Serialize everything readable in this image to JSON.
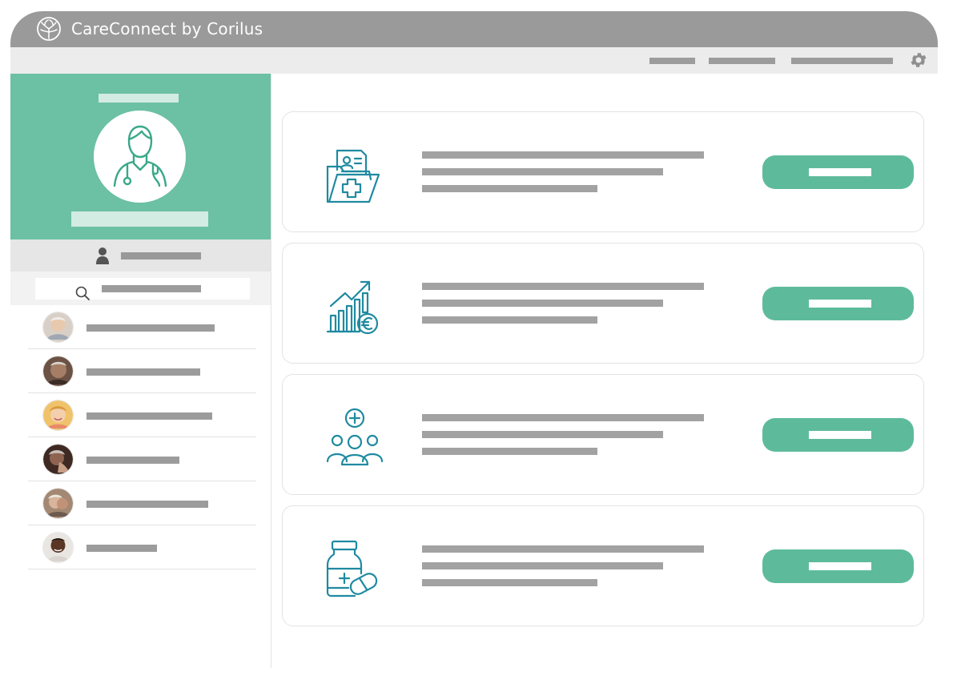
{
  "app": {
    "title": "CareConnect by Corilus",
    "logo_icon": "brain-tree-logo-icon"
  },
  "menu": {
    "items": [
      {
        "name": "menu-item-1"
      },
      {
        "name": "menu-item-2"
      },
      {
        "name": "menu-item-3"
      }
    ],
    "settings_icon": "gear-icon"
  },
  "sidebar": {
    "profile_icon": "doctor-icon",
    "user_icon": "user-icon",
    "search_icon": "search-icon",
    "patients": [
      {
        "avatar_color": "#c9b8a6"
      },
      {
        "avatar_color": "#8a6a58"
      },
      {
        "avatar_color": "#e8b25a"
      },
      {
        "avatar_color": "#5a3a2e"
      },
      {
        "avatar_color": "#b89a86"
      },
      {
        "avatar_color": "#4a2f24"
      }
    ]
  },
  "cards": [
    {
      "icon": "medical-folder-icon"
    },
    {
      "icon": "growth-chart-euro-icon"
    },
    {
      "icon": "patient-group-icon"
    },
    {
      "icon": "medication-icon"
    }
  ],
  "colors": {
    "titlebar": "#9a9a9a",
    "accent_green": "#6cc0a4",
    "button_green": "#5dbb9c",
    "icon_teal": "#1f8aa0",
    "placeholder_gray": "#a2a2a2"
  }
}
